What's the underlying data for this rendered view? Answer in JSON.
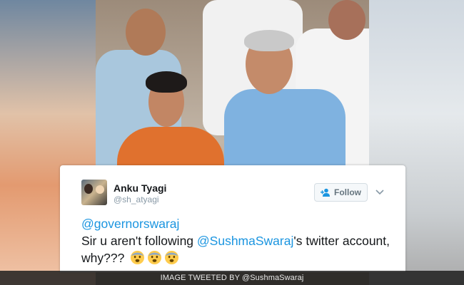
{
  "tweet": {
    "author_name": "Anku Tyagi",
    "author_handle": "@sh_atyagi",
    "follow_label": "Follow",
    "text_mention_1": "@governorswaraj",
    "text_part_1": "Sir u aren't following ",
    "text_mention_2": "@SushmaSwaraj",
    "text_part_2": "'s twitter account,  why???",
    "emojis": [
      "fearful-face",
      "fearful-face",
      "fearful-face"
    ]
  },
  "caption": {
    "text": "IMAGE TWEETED BY @SushmaSwaraj"
  },
  "colors": {
    "mention": "#1b95e0",
    "text": "#14171a",
    "secondary": "#8899a6",
    "follow_text": "#66757f"
  }
}
